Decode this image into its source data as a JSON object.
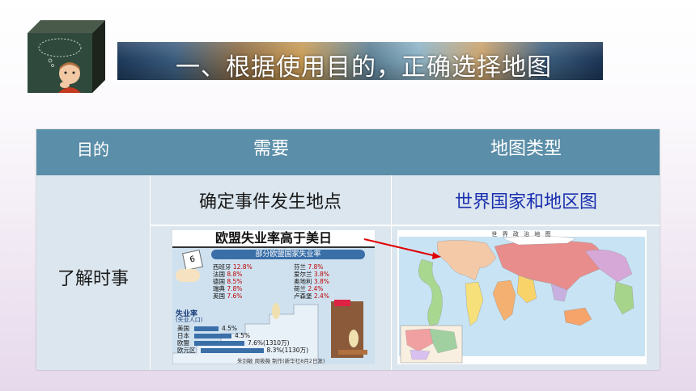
{
  "slide": {
    "title": "一、根据使用目的，正确选择地图"
  },
  "table": {
    "headers": [
      "目的",
      "需要",
      "地图类型"
    ],
    "rows": [
      {
        "purpose": "了解时事",
        "need": "确定事件发生地点",
        "map_type": "世界国家和地区图"
      }
    ]
  },
  "newspaper_chart": {
    "headline": "欧盟失业率高于美日",
    "subtitle": "部分欧盟国家失业率",
    "items": [
      {
        "country": "西班牙",
        "rate": "12.8%"
      },
      {
        "country": "芬兰",
        "rate": "7.8%"
      },
      {
        "country": "法国",
        "rate": "8.8%"
      },
      {
        "country": "爱尔兰",
        "rate": "3.8%"
      },
      {
        "country": "德国",
        "rate": "8.5%"
      },
      {
        "country": "奥地利",
        "rate": "3.8%"
      },
      {
        "country": "瑞典",
        "rate": "7.8%"
      },
      {
        "country": "荷兰",
        "rate": "2.4%"
      },
      {
        "country": "英国",
        "rate": "7.6%"
      },
      {
        "country": "卢森堡",
        "rate": "2.4%"
      }
    ],
    "box_label": "失业率",
    "box_sub": "(失业人口)",
    "compare": [
      {
        "label": "美国",
        "value": "4.5%"
      },
      {
        "label": "日本",
        "value": "4.5%"
      },
      {
        "label": "欧盟",
        "value": "7.6%(1310万)"
      },
      {
        "label": "欧元区",
        "value": "8.3%(1130万)"
      }
    ],
    "credit": "朱剑敏 周筱薇 制作(新华社8月2日发)",
    "calendar_day": "6"
  },
  "world_map": {
    "title": "世 界 政 治 地 图"
  },
  "colors": {
    "header": "#5b8ea8",
    "body": "#dbe6ee",
    "accent_blue": "#1c2fb0",
    "arrow": "#e00000"
  }
}
